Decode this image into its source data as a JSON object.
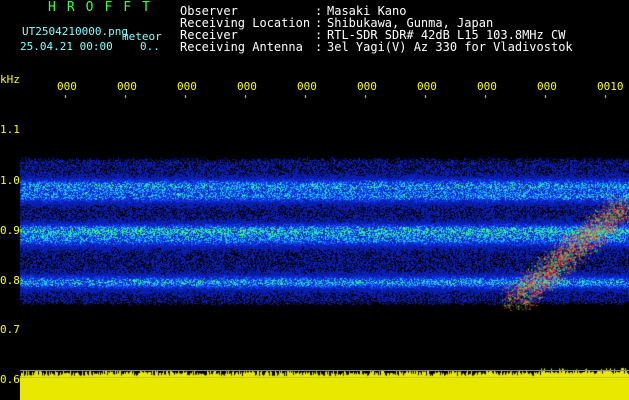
{
  "header": {
    "app_title": "HROFFT",
    "filename": "UT2504210000.png",
    "meteor_label": "meteor",
    "date": "25.04.21 00:00",
    "count": "0..",
    "fields": [
      {
        "label": "Observer",
        "sep": ":",
        "value": "Masaki Kano"
      },
      {
        "label": "Receiving Location",
        "sep": ":",
        "value": "Shibukawa, Gunma, Japan"
      },
      {
        "label": "Receiver",
        "sep": ":",
        "value": "RTL-SDR SDR# 42dB L15 103.8MHz CW"
      },
      {
        "label": "Receiving Antenna",
        "sep": ":",
        "value": "3el Yagi(V) Az 330 for Vladivostok"
      }
    ]
  },
  "axis": {
    "y_unit": "kHz",
    "y_ticks": [
      "1.1",
      "1.0",
      "0.9",
      "0.8",
      "0.7",
      "0.6"
    ],
    "x_ticks": [
      "000",
      "000",
      "000",
      "000",
      "000",
      "000",
      "000",
      "000",
      "000",
      "0010"
    ]
  },
  "colors": {
    "background": "#000000",
    "noise_blue": "#0a2cff",
    "signal_green": "#2cff8a",
    "signal_red": "#ff2020",
    "axis_text": "#ffff00"
  }
}
